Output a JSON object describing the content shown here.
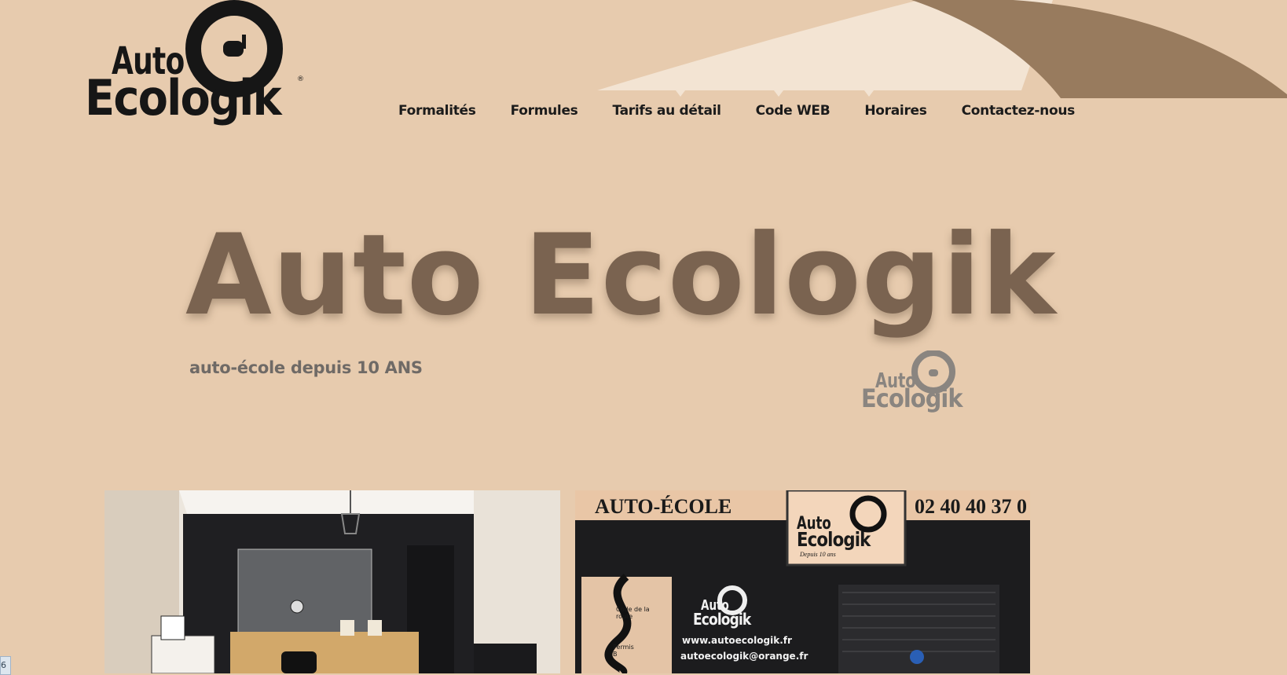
{
  "logo": {
    "line1": "Auto",
    "line2": "Ecologik",
    "registered": "®"
  },
  "nav": {
    "items": [
      {
        "label": "Formalités"
      },
      {
        "label": "Formules"
      },
      {
        "label": "Tarifs au détail"
      },
      {
        "label": "Code WEB"
      },
      {
        "label": "Horaires"
      },
      {
        "label": "Contactez-nous"
      }
    ]
  },
  "hero": {
    "title": "Auto Ecologik",
    "subtitle": "auto-école depuis 10 ANS",
    "logo_line1": "Auto",
    "logo_line2": "Ecologik"
  },
  "photos": {
    "storefront": {
      "sign_left": "AUTO-ÉCOLE",
      "sign_phone": "02 40 40 37 0",
      "sign_logo_line1": "Auto",
      "sign_logo_line2": "Ecologik",
      "sign_logo_tagline": "Depuis 10 ans",
      "window_logo_line1": "Auto",
      "window_logo_line2": "Ecologik",
      "window_website": "www.autoecologik.fr",
      "window_email": "autoecologik@orange.fr",
      "road_label_1": "Code de la route",
      "road_label_2": "Permis B"
    }
  },
  "corner_tab": {
    "label": "6"
  },
  "colors": {
    "background": "#e7cbae",
    "swoosh_dark": "#987b5e",
    "swoosh_light": "#f3e4d3",
    "hero_title": "#7a6350",
    "nav_text": "#1b1b1b"
  }
}
